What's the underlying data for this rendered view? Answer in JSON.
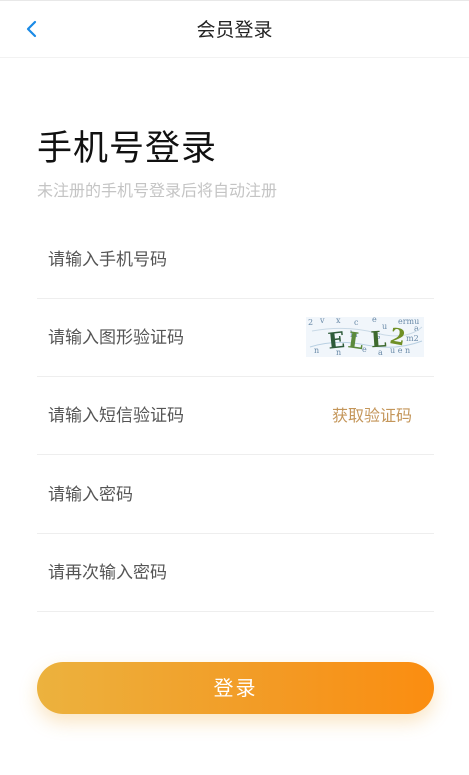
{
  "header": {
    "title": "会员登录",
    "back_icon": "chevron-left-icon",
    "accent_color": "#1a8ae6"
  },
  "main": {
    "title": "手机号登录",
    "subtitle": "未注册的手机号登录后将自动注册"
  },
  "form": {
    "phone_placeholder": "请输入手机号码",
    "captcha_placeholder": "请输入图形验证码",
    "captcha_text": "ELL2",
    "sms_placeholder": "请输入短信验证码",
    "sms_button_label": "获取验证码",
    "password_placeholder": "请输入密码",
    "confirm_password_placeholder": "请再次输入密码"
  },
  "actions": {
    "login_label": "登录",
    "button_color_start": "#ecb23e",
    "button_color_end": "#fb8d10"
  }
}
